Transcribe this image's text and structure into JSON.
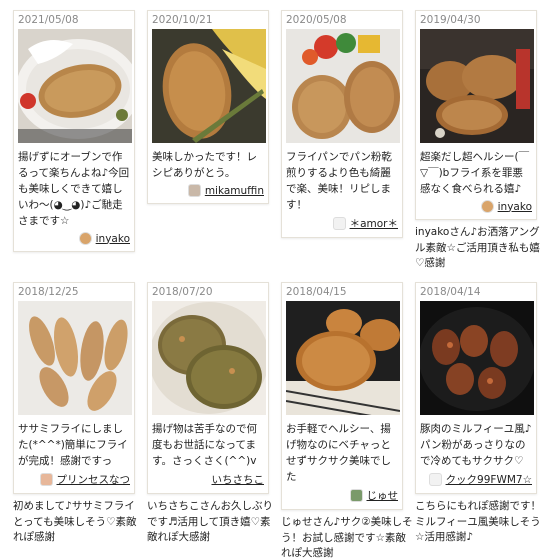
{
  "reports": [
    {
      "date": "2021/05/08",
      "comment": "揚げずにオーブンで作るって楽ちんよね♪今回も美味しくできて嬉しいわ〜(◕‿◕)♪ご馳走さまです☆",
      "author": "inyako",
      "reply": ""
    },
    {
      "date": "2020/10/21",
      "comment": "美味しかったです！レシピありがとう。",
      "author": "mikamuffin",
      "reply": ""
    },
    {
      "date": "2020/05/08",
      "comment": "フライパンでパン粉乾煎りするより色も綺麗で楽、美味！リピします！",
      "author": "＊amor＊",
      "reply": ""
    },
    {
      "date": "2019/04/30",
      "comment": "超楽だし超ヘルシー(￣▽￣)bフライ系を罪悪感なく食べられる嬉♪",
      "author": "inyako",
      "reply": "inyakoさん♪お洒落アングル素敵☆ご活用頂き私も嬉♡感謝"
    },
    {
      "date": "2018/12/25",
      "comment": "ササミフライにしました(*^^*)簡単にフライが完成！感謝ですっ",
      "author": "プリンセスなつ",
      "reply": "初めまして♪ササミフライとっても美味しそう♡素敵れぽ感謝"
    },
    {
      "date": "2018/07/20",
      "comment": "揚げ物は苦手なので何度もお世話になってます。さっくさく(^^)v",
      "author": "いちさちこ",
      "reply": "いちさちこさんお久しぶりです♬活用して頂き嬉♡素敵れぽ大感謝"
    },
    {
      "date": "2018/04/15",
      "comment": "お手軽でヘルシー、揚げ物なのにベチャっとせずサクサク美味でした",
      "author": "じゅせ",
      "reply": "じゅせさん♪サク②美味しそう！お試し感謝です☆素敵れぽ大感謝"
    },
    {
      "date": "2018/04/14",
      "comment": "豚肉のミルフィーユ風♪パン粉があっさりなので冷めてもサクサク♡",
      "author": "クック99FWM7☆",
      "reply": "こちらにもれぽ感謝です！ミルフィーユ風美味しそう☆活用感謝♪"
    }
  ]
}
